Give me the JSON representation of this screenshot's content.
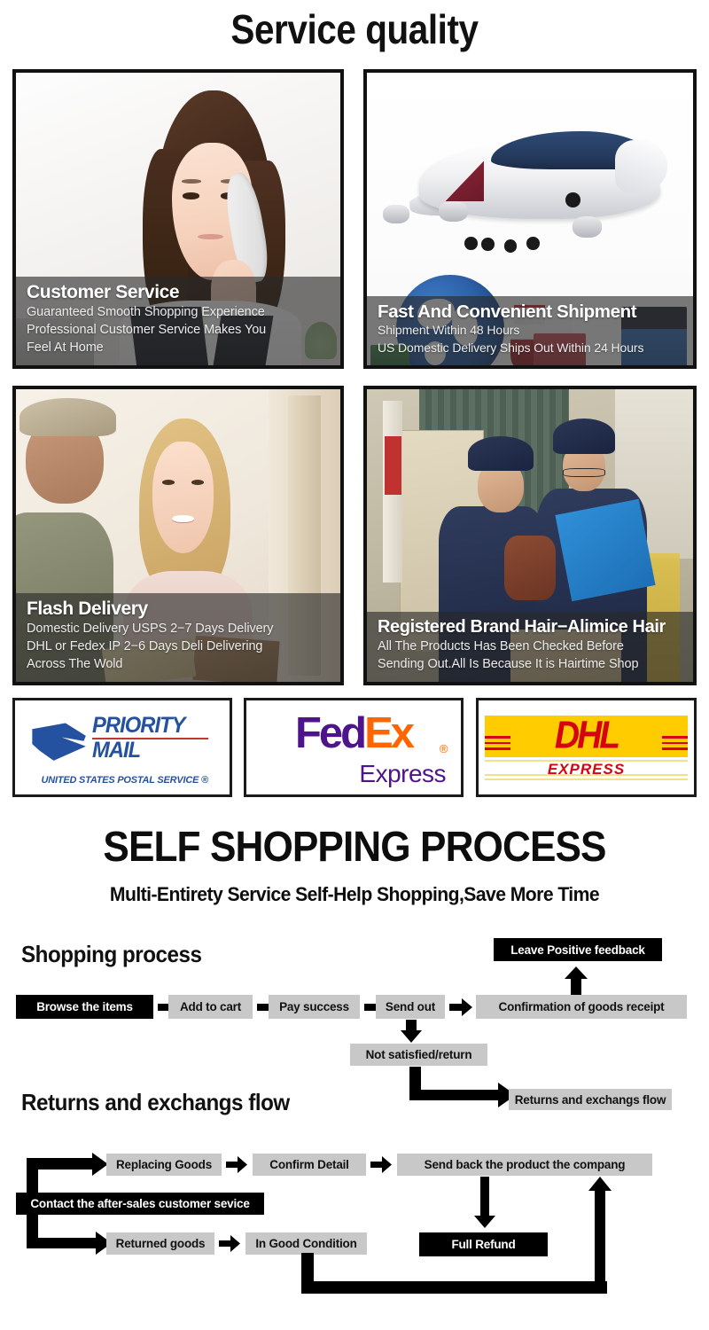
{
  "header": {
    "title": "Service quality"
  },
  "cards": [
    {
      "name": "customer-service",
      "title": "Customer Service",
      "lines": [
        "Guaranteed Smooth Shopping Experience",
        "Professional Customer Service Makes You",
        "Feel At Home"
      ]
    },
    {
      "name": "fast-shipment",
      "title": "Fast And Convenient Shipment",
      "lines": [
        "Shipment Within 48 Hours",
        "US Domestic Delivery Ships Out Within 24 Hours"
      ]
    },
    {
      "name": "flash-delivery",
      "title": "Flash Delivery",
      "lines": [
        "Domestic Delivery USPS 2−7 Days Delivery",
        "DHL or Fedex IP 2−6 Days Deli Delivering",
        "Across The Wold"
      ]
    },
    {
      "name": "registered-brand",
      "title": "Registered Brand Hair−Alimice Hair",
      "lines": [
        "All The Products Has Been Checked Before",
        "Sending Out.All Is Because It is Hairtime Shop"
      ]
    }
  ],
  "couriers": [
    {
      "name": "usps",
      "line1": "PRIORITY",
      "line2": "MAIL",
      "sub": "UNITED STATES POSTAL SERVICE ®",
      "color": "#2552a0"
    },
    {
      "name": "fedex",
      "fed": "Fed",
      "ex": "Ex",
      "reg": "®",
      "express": "Express",
      "color_fed": "#4d148c",
      "color_ex": "#ff6600"
    },
    {
      "name": "dhl",
      "wordmark": "DHL",
      "express": "EXPRESS",
      "band_color": "#ffcc00",
      "text_color": "#d40511"
    }
  ],
  "process": {
    "title": "SELF SHOPPING PROCESS",
    "subtitle": "Multi-Entirety Service Self-Help Shopping,Save More Time",
    "shopping_heading": "Shopping process",
    "returns_heading": "Returns and exchangs flow",
    "steps": [
      {
        "label": "Browse the items",
        "style": "black"
      },
      {
        "label": "Add to cart",
        "style": "gray"
      },
      {
        "label": "Pay success",
        "style": "gray"
      },
      {
        "label": "Send out",
        "style": "gray"
      },
      {
        "label": "Confirmation of goods receipt",
        "style": "gray"
      }
    ],
    "feedback": {
      "label": "Leave Positive feedback",
      "style": "black"
    },
    "not_satisfied": {
      "label": "Not satisfied/return",
      "style": "gray"
    },
    "returns_target": {
      "label": "Returns and exchangs flow",
      "style": "gray"
    },
    "returns_steps": [
      {
        "label": "Replacing Goods",
        "style": "gray"
      },
      {
        "label": "Confirm Detail",
        "style": "gray"
      },
      {
        "label": "Send back the product the compang",
        "style": "gray"
      }
    ],
    "contact": {
      "label": "Contact the after-sales customer sevice",
      "style": "black"
    },
    "returned_steps": [
      {
        "label": "Returned goods",
        "style": "gray"
      },
      {
        "label": "In Good Condition",
        "style": "gray"
      }
    ],
    "refund": {
      "label": "Full Refund",
      "style": "black"
    }
  },
  "colors": {
    "gray_box": "#c8c8c8",
    "black_box": "#000000",
    "card_border": "#111111"
  }
}
